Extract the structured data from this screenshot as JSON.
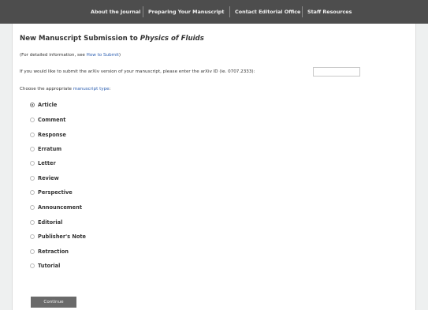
{
  "nav": {
    "items": [
      "About the Journal",
      "Preparing Your Manuscript",
      "Contact Editorial Office",
      "Staff Resources"
    ]
  },
  "form": {
    "title_prefix": "New Manuscript Submission to ",
    "title_journal": "Physics of Fluids",
    "info_prefix": "(For detailed information, see ",
    "info_link": "How to Submit",
    "info_suffix": ")",
    "arxiv_prompt": "If you would like to submit the arXiv version of your manuscript, please enter the arXiv ID (ie. 0707.2333):",
    "arxiv_value": "",
    "choose_prefix": "Choose the appropriate ",
    "choose_link": "manuscript type",
    "choose_suffix": ":",
    "types": [
      "Article",
      "Comment",
      "Response",
      "Erratum",
      "Letter",
      "Review",
      "Perspective",
      "Announcement",
      "Editorial",
      "Publisher's Note",
      "Retraction",
      "Tutorial"
    ],
    "selected_type": "Article",
    "continue_label": "Continue"
  }
}
